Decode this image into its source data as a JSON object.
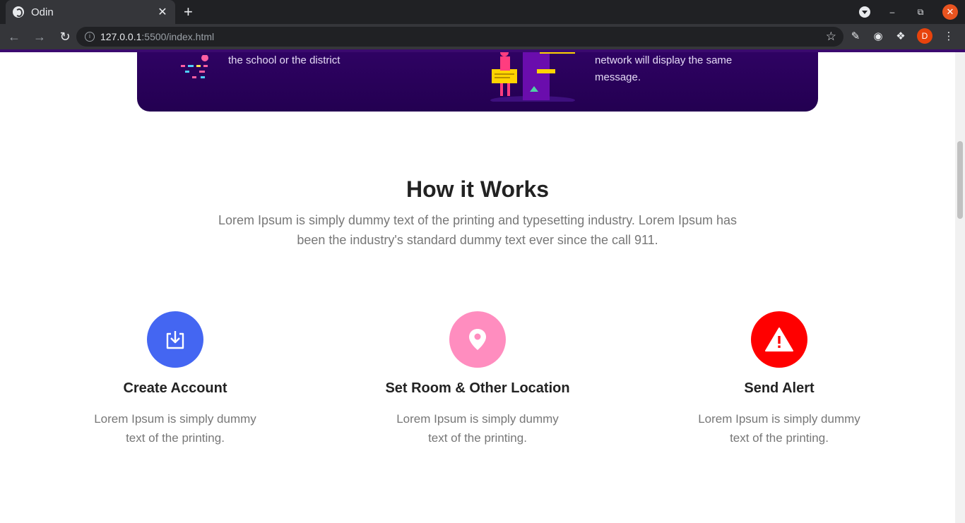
{
  "browser": {
    "tab_title": "Odin",
    "tab_close": "✕",
    "new_tab": "+",
    "url_host": "127.0.0.1",
    "url_path": ":5500/index.html",
    "profile_initial": "D"
  },
  "colors": {
    "purple_card": "#2a0560",
    "step1": "#4466f2",
    "step2": "#ff8dbf",
    "step3": "#ff0000"
  },
  "banner": {
    "left_text": "the school or the district",
    "right_text": "network will display the same message."
  },
  "how_it_works": {
    "title": "How it Works",
    "subtitle": "Lorem Ipsum is simply dummy text of the printing and typesetting industry. Lorem Ipsum has been the industry's standard dummy text ever since the call 911."
  },
  "steps": [
    {
      "title": "Create Account",
      "text": "Lorem Ipsum is simply dummy text of the printing.",
      "icon": "download-box-icon"
    },
    {
      "title": "Set Room & Other Location",
      "text": "Lorem Ipsum is simply dummy text of the printing.",
      "icon": "location-pin-icon"
    },
    {
      "title": "Send Alert",
      "text": "Lorem Ipsum is simply dummy text of the printing.",
      "icon": "warning-icon"
    }
  ]
}
